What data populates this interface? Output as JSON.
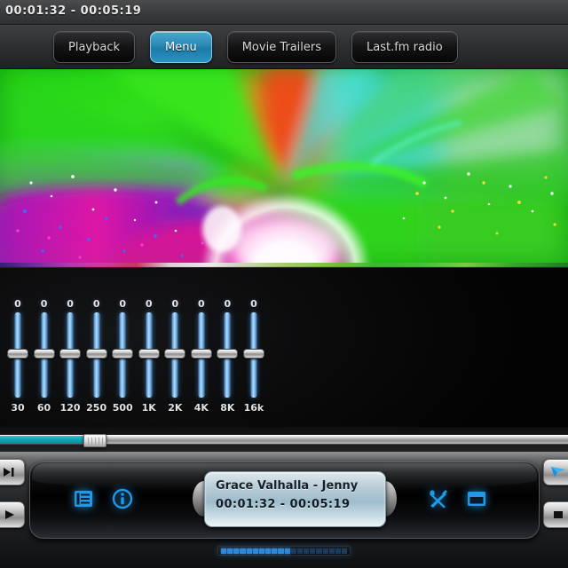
{
  "window": {
    "title": "y  00:01:32 - 00:05:19"
  },
  "toolbar": {
    "tabs": [
      {
        "label": "Playback",
        "active": false
      },
      {
        "label": "Menu",
        "active": true
      },
      {
        "label": "Movie Trailers",
        "active": false
      },
      {
        "label": "Last.fm radio",
        "active": false
      }
    ]
  },
  "visualizer": {
    "name": "music-visualization",
    "description": "psychedelic particle burst with glowing white sphere"
  },
  "equalizer": {
    "bands": [
      {
        "label": "30",
        "value": "0"
      },
      {
        "label": "60",
        "value": "0"
      },
      {
        "label": "120",
        "value": "0"
      },
      {
        "label": "250",
        "value": "0"
      },
      {
        "label": "500",
        "value": "0"
      },
      {
        "label": "1K",
        "value": "0"
      },
      {
        "label": "2K",
        "value": "0"
      },
      {
        "label": "4K",
        "value": "0"
      },
      {
        "label": "8K",
        "value": "0"
      },
      {
        "label": "16k",
        "value": "0"
      }
    ]
  },
  "seek": {
    "progress_percent": 16,
    "fill_color": "#13a6b3"
  },
  "player": {
    "track_title": "Grace Valhalla - Jenny",
    "track_time": "00:01:32 - 00:05:19",
    "icons": {
      "playlist": "playlist-icon",
      "info": "info-icon",
      "tools": "tools-icon",
      "window": "window-icon"
    }
  },
  "colors": {
    "accent_blue": "#2893c0",
    "icon_blue": "#1f9ae8",
    "seek_teal": "#13a6b3"
  }
}
